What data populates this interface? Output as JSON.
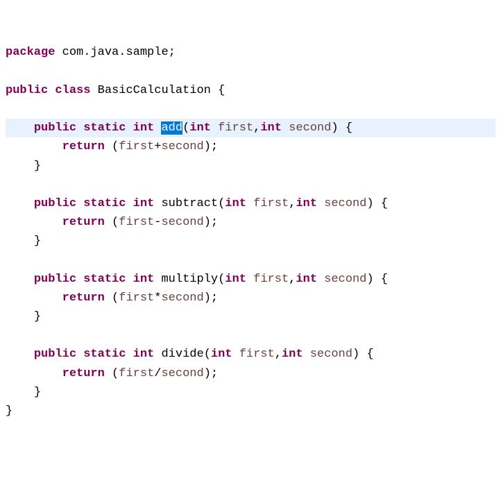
{
  "code": {
    "line1": {
      "package": "package",
      "pkg_name": "com.java.sample",
      "semi": ";"
    },
    "line3": {
      "public": "public",
      "class": "class",
      "class_name": "BasicCalculation",
      "brace": "{"
    },
    "add": {
      "public": "public",
      "static": "static",
      "ret_type": "int",
      "name": "add",
      "lparen": "(",
      "p1_type": "int",
      "p1_name": "first",
      "comma": ",",
      "p2_type": "int",
      "p2_name": "second",
      "rparen": ")",
      "brace": "{",
      "return": "return",
      "expr_l": "(",
      "expr_a": "first",
      "op": "+",
      "expr_b": "second",
      "expr_r": ")",
      "semi": ";",
      "close": "}"
    },
    "subtract": {
      "public": "public",
      "static": "static",
      "ret_type": "int",
      "name": "subtract",
      "lparen": "(",
      "p1_type": "int",
      "p1_name": "first",
      "comma": ",",
      "p2_type": "int",
      "p2_name": "second",
      "rparen": ")",
      "brace": "{",
      "return": "return",
      "expr_l": "(",
      "expr_a": "first",
      "op": "-",
      "expr_b": "second",
      "expr_r": ")",
      "semi": ";",
      "close": "}"
    },
    "multiply": {
      "public": "public",
      "static": "static",
      "ret_type": "int",
      "name": "multiply",
      "lparen": "(",
      "p1_type": "int",
      "p1_name": "first",
      "comma": ",",
      "p2_type": "int",
      "p2_name": "second",
      "rparen": ")",
      "brace": "{",
      "return": "return",
      "expr_l": "(",
      "expr_a": "first",
      "op": "*",
      "expr_b": "second",
      "expr_r": ")",
      "semi": ";",
      "close": "}"
    },
    "divide": {
      "public": "public",
      "static": "static",
      "ret_type": "int",
      "name": "divide",
      "lparen": "(",
      "p1_type": "int",
      "p1_name": "first",
      "comma": ",",
      "p2_type": "int",
      "p2_name": "second",
      "rparen": ")",
      "brace": "{",
      "return": "return",
      "expr_l": "(",
      "expr_a": "first",
      "op": "/",
      "expr_b": "second",
      "expr_r": ")",
      "semi": ";",
      "close": "}"
    },
    "close_class": "}"
  }
}
